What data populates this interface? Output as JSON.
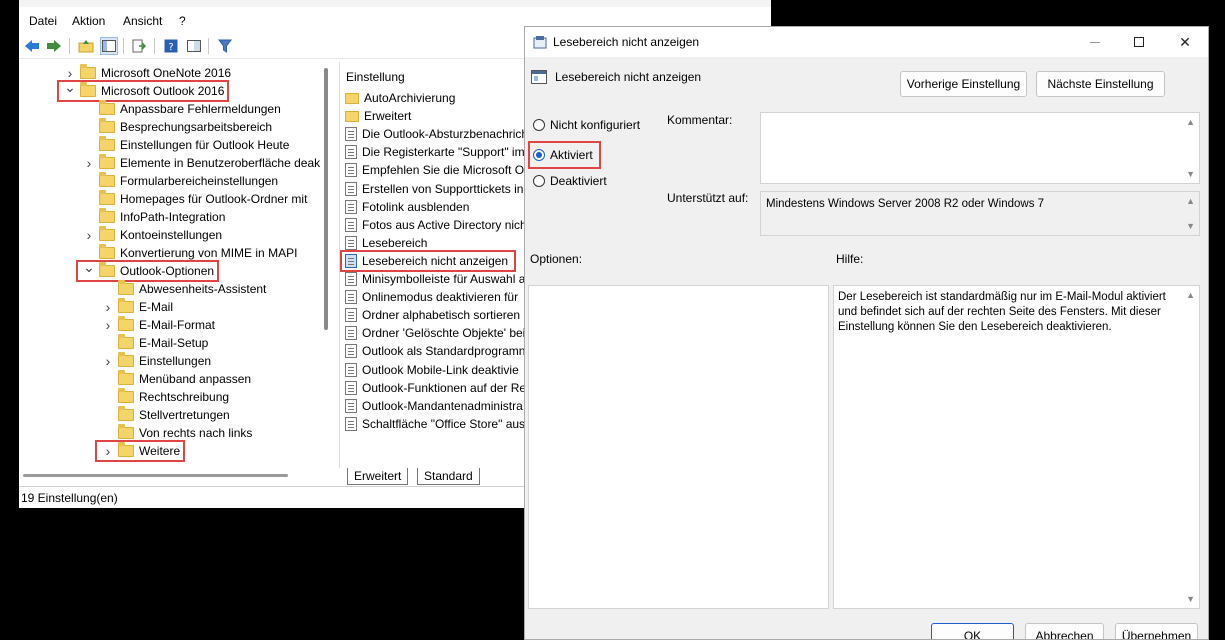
{
  "main_window": {
    "menu": [
      "Datei",
      "Aktion",
      "Ansicht",
      "?"
    ],
    "tree": [
      {
        "label": "Microsoft OneNote 2016",
        "level": 0,
        "chevron": "right",
        "highlight": false
      },
      {
        "label": "Microsoft Outlook 2016",
        "level": 0,
        "chevron": "down",
        "highlight": true
      },
      {
        "label": "Anpassbare Fehlermeldungen",
        "level": 1,
        "chevron": "",
        "highlight": false
      },
      {
        "label": "Besprechungsarbeitsbereich",
        "level": 1,
        "chevron": "",
        "highlight": false
      },
      {
        "label": "Einstellungen für Outlook Heute",
        "level": 1,
        "chevron": "",
        "highlight": false
      },
      {
        "label": "Elemente in Benutzeroberfläche deak",
        "level": 1,
        "chevron": "right",
        "highlight": false
      },
      {
        "label": "Formularbereicheinstellungen",
        "level": 1,
        "chevron": "",
        "highlight": false
      },
      {
        "label": "Homepages für Outlook-Ordner mit",
        "level": 1,
        "chevron": "",
        "highlight": false
      },
      {
        "label": "InfoPath-Integration",
        "level": 1,
        "chevron": "",
        "highlight": false
      },
      {
        "label": "Kontoeinstellungen",
        "level": 1,
        "chevron": "right",
        "highlight": false
      },
      {
        "label": "Konvertierung von MIME in MAPI",
        "level": 1,
        "chevron": "",
        "highlight": false
      },
      {
        "label": "Outlook-Optionen",
        "level": 1,
        "chevron": "down",
        "highlight": true
      },
      {
        "label": "Abwesenheits-Assistent",
        "level": 2,
        "chevron": "",
        "highlight": false
      },
      {
        "label": "E-Mail",
        "level": 2,
        "chevron": "right",
        "highlight": false
      },
      {
        "label": "E-Mail-Format",
        "level": 2,
        "chevron": "right",
        "highlight": false
      },
      {
        "label": "E-Mail-Setup",
        "level": 2,
        "chevron": "",
        "highlight": false
      },
      {
        "label": "Einstellungen",
        "level": 2,
        "chevron": "right",
        "highlight": false
      },
      {
        "label": "Menüband anpassen",
        "level": 2,
        "chevron": "",
        "highlight": false
      },
      {
        "label": "Rechtschreibung",
        "level": 2,
        "chevron": "",
        "highlight": false
      },
      {
        "label": "Stellvertretungen",
        "level": 2,
        "chevron": "",
        "highlight": false
      },
      {
        "label": "Von rechts nach links",
        "level": 2,
        "chevron": "",
        "highlight": false
      },
      {
        "label": "Weitere",
        "level": 2,
        "chevron": "right",
        "highlight": true
      }
    ],
    "settings_header": "Einstellung",
    "settings": [
      {
        "label": "AutoArchivierung",
        "icon": "folder",
        "selected": false
      },
      {
        "label": "Erweitert",
        "icon": "folder",
        "selected": false
      },
      {
        "label": "Die Outlook-Absturzbenachrich",
        "icon": "doc",
        "selected": false
      },
      {
        "label": "Die Registerkarte \"Support\" im",
        "icon": "doc",
        "selected": false
      },
      {
        "label": "Empfehlen Sie die Microsoft O",
        "icon": "doc",
        "selected": false
      },
      {
        "label": "Erstellen von Supporttickets in",
        "icon": "doc",
        "selected": false
      },
      {
        "label": "Fotolink ausblenden",
        "icon": "doc",
        "selected": false
      },
      {
        "label": "Fotos aus Active Directory nich",
        "icon": "doc",
        "selected": false
      },
      {
        "label": "Lesebereich",
        "icon": "doc",
        "selected": false
      },
      {
        "label": "Lesebereich nicht anzeigen",
        "icon": "doc",
        "selected": true
      },
      {
        "label": "Minisymbolleiste für Auswahl a",
        "icon": "doc",
        "selected": false
      },
      {
        "label": "Onlinemodus deaktivieren für",
        "icon": "doc",
        "selected": false
      },
      {
        "label": "Ordner alphabetisch sortieren",
        "icon": "doc",
        "selected": false
      },
      {
        "label": "Ordner 'Gelöschte Objekte' bei",
        "icon": "doc",
        "selected": false
      },
      {
        "label": "Outlook als Standardprogramn",
        "icon": "doc",
        "selected": false
      },
      {
        "label": "Outlook Mobile-Link deaktivie",
        "icon": "doc",
        "selected": false
      },
      {
        "label": "Outlook-Funktionen auf der Re",
        "icon": "doc",
        "selected": false
      },
      {
        "label": "Outlook-Mandantenadministra",
        "icon": "doc",
        "selected": false
      },
      {
        "label": "Schaltfläche \"Office Store\" aus",
        "icon": "doc",
        "selected": false
      }
    ],
    "tabs": [
      "Erweitert",
      "Standard"
    ],
    "status": "19 Einstellung(en)"
  },
  "dialog": {
    "title": "Lesebereich nicht anzeigen",
    "policy_name": "Lesebereich nicht anzeigen",
    "prev_button": "Vorherige Einstellung",
    "next_button": "Nächste Einstellung",
    "radios": {
      "not_configured": "Nicht konfiguriert",
      "enabled": "Aktiviert",
      "disabled": "Deaktiviert"
    },
    "comment_label": "Kommentar:",
    "supported_label": "Unterstützt auf:",
    "supported_value": "Mindestens Windows Server 2008 R2 oder Windows 7",
    "options_label": "Optionen:",
    "help_label": "Hilfe:",
    "help_text": "Der Lesebereich ist standardmäßig nur im E-Mail-Modul aktiviert und befindet sich auf der rechten Seite des Fensters. Mit dieser Einstellung können Sie den Lesebereich deaktivieren.",
    "ok": "OK",
    "cancel": "Abbrechen",
    "apply": "Übernehmen"
  },
  "colors": {
    "accent": "#1d5ecf",
    "highlight": "#e04444",
    "folder": "#f5d56a"
  }
}
